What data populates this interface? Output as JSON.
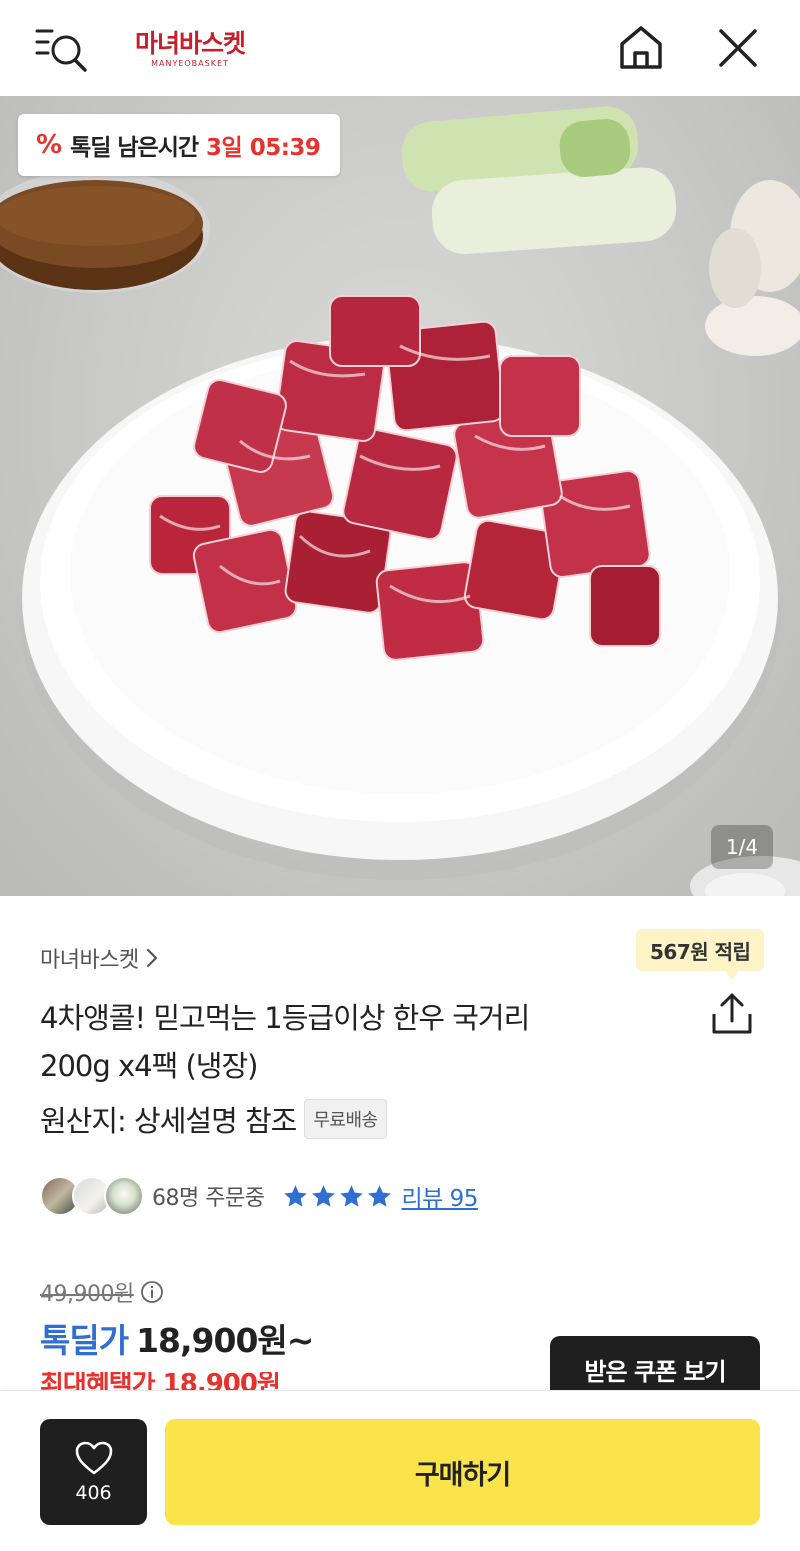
{
  "header": {
    "logo_text": "마녀바스켓",
    "logo_subtext": "MANYEOBASKET",
    "menu_icon": "menu-search-icon",
    "home_icon": "home-icon",
    "close_icon": "close-icon"
  },
  "hero": {
    "deal_icon": "%",
    "deal_label": "톡딜 남은시간",
    "deal_time": "3일 05:39",
    "image_counter": "1/4"
  },
  "product": {
    "seller": "마녀바스켓",
    "points_badge": "567원 적립",
    "title_line1": "4차앵콜! 믿고먹는 1등급이상 한우 국거리",
    "title_line2": "200g x4팩 (냉장)",
    "origin": "원산지: 상세설명 참조",
    "shipping_badge": "무료배송",
    "orders_text": "68명 주문중",
    "rating_stars": 4,
    "review_text": "리뷰 95",
    "original_price": "49,900원",
    "deal_label": "톡딜가",
    "deal_price": "18,900원~",
    "coupon_price": "최대혜택가 18,900원",
    "coupon_button": "받은 쿠폰 보기"
  },
  "bottom_bar": {
    "like_count": "406",
    "buy_label": "구매하기"
  },
  "colors": {
    "brand_red": "#c8202a",
    "deal_red": "#e8322d",
    "deal_blue": "#2e6fd1",
    "buy_yellow": "#fbe34b",
    "dark": "#1f1f1f"
  }
}
